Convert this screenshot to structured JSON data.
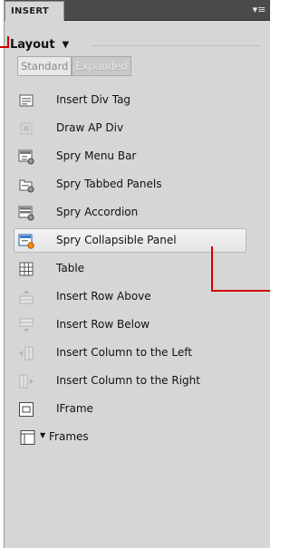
{
  "panel": {
    "tab_label": "INSERT",
    "menu_icon": "panel-options-icon"
  },
  "category": {
    "label": "Layout",
    "dropdown_icon": "dropdown-arrow-icon"
  },
  "modes": [
    {
      "label": "Standard",
      "active": true
    },
    {
      "label": "Expanded",
      "active": false
    }
  ],
  "items": [
    {
      "label": "Insert Div Tag",
      "icon": "div-tag-icon"
    },
    {
      "label": "Draw AP Div",
      "icon": "ap-div-icon"
    },
    {
      "label": "Spry Menu Bar",
      "icon": "spry-menu-bar-icon"
    },
    {
      "label": "Spry Tabbed Panels",
      "icon": "spry-tabbed-panels-icon"
    },
    {
      "label": "Spry Accordion",
      "icon": "spry-accordion-icon"
    },
    {
      "label": "Spry Collapsible Panel",
      "icon": "spry-collapsible-panel-icon",
      "selected": true
    },
    {
      "label": "Table",
      "icon": "table-icon"
    },
    {
      "label": "Insert Row Above",
      "icon": "row-above-icon"
    },
    {
      "label": "Insert Row Below",
      "icon": "row-below-icon"
    },
    {
      "label": "Insert Column to the Left",
      "icon": "column-left-icon"
    },
    {
      "label": "Insert Column to the Right",
      "icon": "column-right-icon"
    },
    {
      "label": "IFrame",
      "icon": "iframe-icon"
    },
    {
      "label": "Frames",
      "icon": "frames-icon"
    }
  ],
  "colors": {
    "annotation": "#d00000",
    "panel_bg": "#d6d6d6",
    "titlebar": "#4a4a4a"
  }
}
